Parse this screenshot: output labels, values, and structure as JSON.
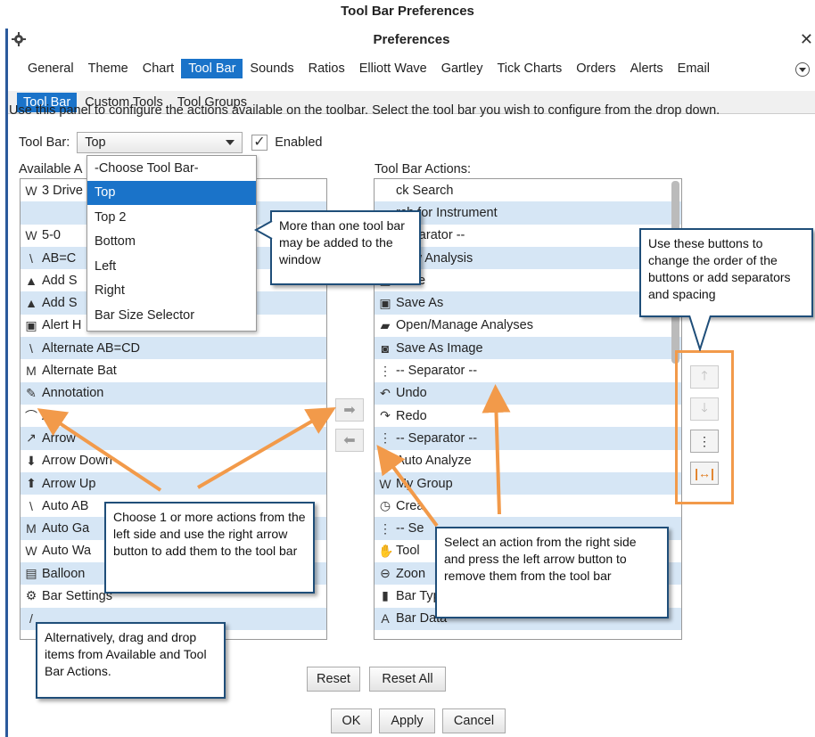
{
  "page_heading": "Tool Bar Preferences",
  "window": {
    "title": "Preferences"
  },
  "main_tabs": [
    "General",
    "Theme",
    "Chart",
    "Tool Bar",
    "Sounds",
    "Ratios",
    "Elliott Wave",
    "Gartley",
    "Tick Charts",
    "Orders",
    "Alerts",
    "Email"
  ],
  "active_main_tab": "Tool Bar",
  "sub_tabs": [
    "Tool Bar",
    "Custom Tools",
    "Tool Groups"
  ],
  "description": "Use this panel to configure the actions available on the toolbar.  Select the tool bar you wish to configure from the drop down.",
  "toolbar_select": {
    "label": "Tool Bar:",
    "value": "Top",
    "enabled_label": "Enabled",
    "enabled": true
  },
  "dropdown_options": [
    "-Choose Tool Bar-",
    "Top",
    "Top 2",
    "Bottom",
    "Left",
    "Right",
    "Bar Size Selector"
  ],
  "available_label": "Available A",
  "actions_label": "Tool Bar Actions:",
  "available_items": [
    {
      "label": "3 Drive",
      "icon": "wave-icon"
    },
    {
      "label": "",
      "icon": "blank"
    },
    {
      "label": "5-0",
      "icon": "wave-icon"
    },
    {
      "label": "AB=C",
      "icon": "zigzag-icon"
    },
    {
      "label": "Add S",
      "icon": "mountain-icon"
    },
    {
      "label": "Add S",
      "icon": "mountain-icon"
    },
    {
      "label": "Alert H",
      "icon": "alert-icon"
    },
    {
      "label": "Alternate AB=CD",
      "icon": "zigzag-icon"
    },
    {
      "label": "Alternate Bat",
      "icon": "bat-icon"
    },
    {
      "label": "Annotation",
      "icon": "annotation-icon"
    },
    {
      "label": "Arc",
      "icon": "arc-icon"
    },
    {
      "label": "Arrow",
      "icon": "arrow-icon"
    },
    {
      "label": "Arrow Down",
      "icon": "arrow-down-icon"
    },
    {
      "label": "Arrow Up",
      "icon": "arrow-up-icon"
    },
    {
      "label": "Auto AB",
      "icon": "zigzag-icon"
    },
    {
      "label": "Auto Ga",
      "icon": "bat-icon"
    },
    {
      "label": "Auto Wa",
      "icon": "wave-icon"
    },
    {
      "label": "Balloon",
      "icon": "balloon-icon"
    },
    {
      "label": "Bar Settings",
      "icon": "settings-icon"
    },
    {
      "label": "",
      "icon": "line-icon"
    }
  ],
  "action_items": [
    {
      "label": "ck Search",
      "icon": "blank"
    },
    {
      "label": "rch for Instrument",
      "icon": "blank"
    },
    {
      "label": "Separator --",
      "icon": "blank"
    },
    {
      "label": "New Analysis",
      "icon": "doc-icon"
    },
    {
      "label": "Save",
      "icon": "save-icon"
    },
    {
      "label": "Save As",
      "icon": "save-as-icon"
    },
    {
      "label": "Open/Manage Analyses",
      "icon": "folder-icon"
    },
    {
      "label": "Save As Image",
      "icon": "camera-icon"
    },
    {
      "label": "-- Separator --",
      "icon": "separator-icon"
    },
    {
      "label": "Undo",
      "icon": "undo-icon"
    },
    {
      "label": "Redo",
      "icon": "redo-icon"
    },
    {
      "label": "-- Separator --",
      "icon": "separator-icon"
    },
    {
      "label": "Auto Analyze",
      "icon": "magic-icon"
    },
    {
      "label": "My Group",
      "icon": "wave-icon"
    },
    {
      "label": "Crea",
      "icon": "alarm-icon"
    },
    {
      "label": "-- Se",
      "icon": "separator-icon"
    },
    {
      "label": "Tool",
      "icon": "hand-icon"
    },
    {
      "label": "Zoon",
      "icon": "zoom-icon"
    },
    {
      "label": "Bar Type",
      "icon": "candle-icon"
    },
    {
      "label": "Bar Data",
      "icon": "bar-data-icon"
    }
  ],
  "buttons": {
    "reset": "Reset",
    "reset_all": "Reset All",
    "ok": "OK",
    "apply": "Apply",
    "cancel": "Cancel"
  },
  "callouts": {
    "dropdown": "More than one tool bar may be added to the window",
    "order": "Use these buttons to change the order of the buttons or add separators and spacing",
    "left": "Choose 1 or more actions from the left side and use the right arrow button to add them to the tool bar",
    "right": "Select an action from the right side and press the left arrow button to remove them from the tool bar",
    "drag": "Alternatively, drag and drop items from Available and Tool Bar Actions."
  },
  "colors": {
    "accent": "#1a73c9",
    "row_alt": "#d6e6f5",
    "annotation": "#f29a4a",
    "callout_border": "#1f4e79"
  }
}
